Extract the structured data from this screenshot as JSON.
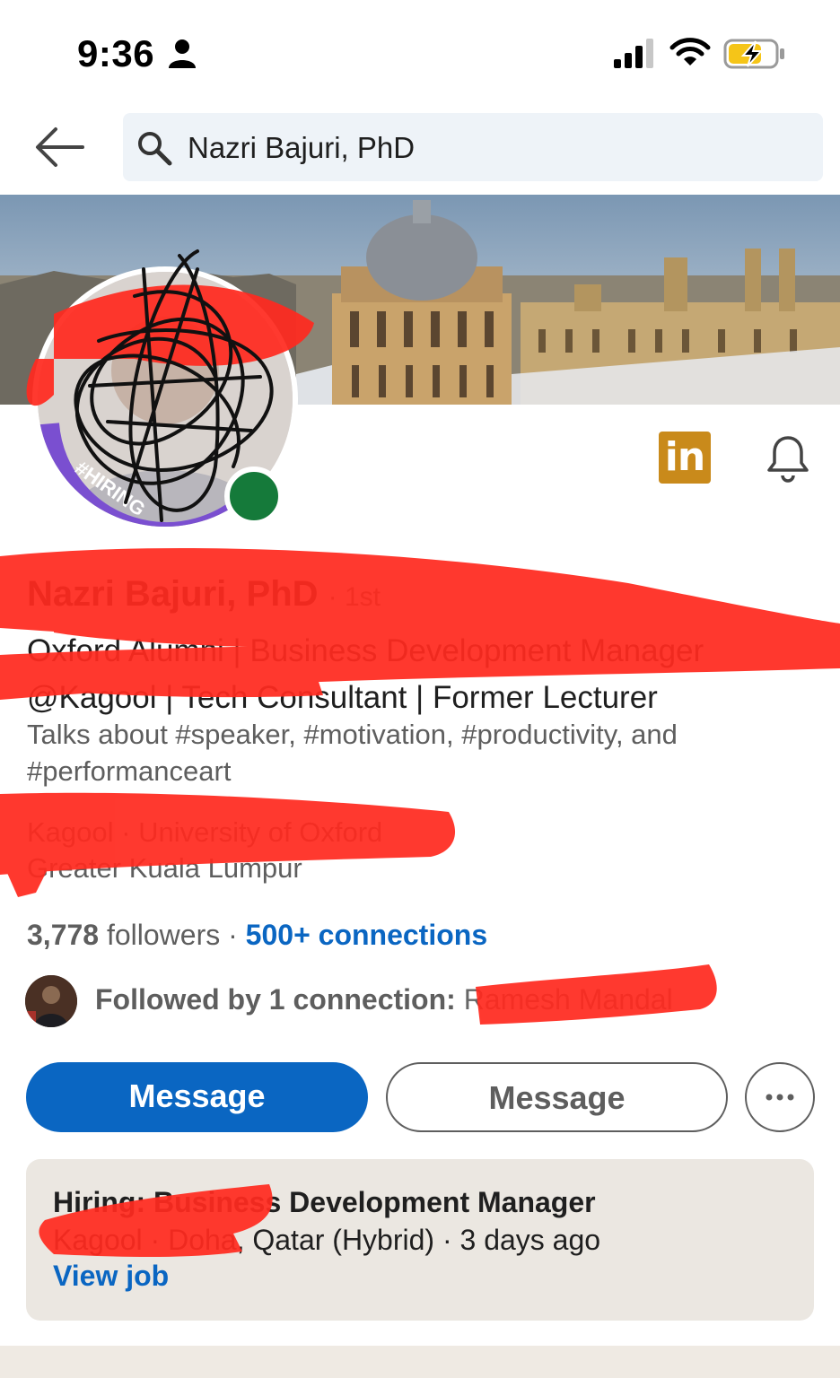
{
  "status_bar": {
    "time": "9:36"
  },
  "header": {
    "search_text": "Nazri Bajuri, PhD"
  },
  "profile": {
    "name": "Nazri Bajuri, PhD",
    "degree": "· 1st",
    "headline": "Oxford Alumni | Business Development Manager @Kagool | Tech Consultant | Former Lecturer",
    "talks_about": "Talks about #speaker, #motivation, #productivity, and #performanceart",
    "company": "Kagool · University of Oxford",
    "location": "Greater Kuala Lumpur",
    "followers_count": "3,778",
    "followers_label": "followers",
    "separator": "·",
    "connections": "500+ connections",
    "mutual_prefix": "Followed by 1 connection:",
    "mutual_name": "Ramesh Mandal",
    "avatar_tag": "#HIRING",
    "badge_text": "in"
  },
  "actions": {
    "primary_label": "Message",
    "secondary_label": "Message",
    "more_label": "···"
  },
  "hiring": {
    "title": "Hiring: Business Development Manager",
    "meta": "Kagool · Doha, Qatar (Hybrid) · 3 days ago",
    "link": "View job"
  },
  "colors": {
    "brand_blue": "#0a66c2",
    "online_green": "#157a3a",
    "badge_gold": "#c98a1b",
    "card_bg": "#ebe7e1",
    "search_bg": "#eef3f8"
  },
  "icons": [
    "person-icon",
    "signal-icon",
    "wifi-icon",
    "battery-charging-icon",
    "back-arrow-icon",
    "search-icon",
    "linkedin-icon",
    "bell-icon",
    "more-icon"
  ]
}
